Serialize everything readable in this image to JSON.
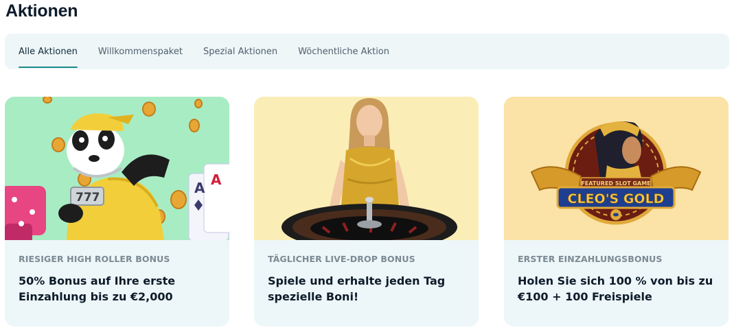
{
  "page": {
    "title": "Aktionen"
  },
  "tabs": [
    {
      "label": "Alle Aktionen",
      "active": true
    },
    {
      "label": "Willkommenspaket",
      "active": false
    },
    {
      "label": "Spezial Aktionen",
      "active": false
    },
    {
      "label": "Wöchentliche Aktion",
      "active": false
    }
  ],
  "cards": [
    {
      "category": "RIESIGER HIGH ROLLER BONUS",
      "text": "50% Bonus auf Ihre erste\nEinzahlung bis zu €2,000",
      "image_bg": "#a8ecc4"
    },
    {
      "category": "TÄGLICHER LIVE-DROP BONUS",
      "text": "Spiele und erhalte jeden Tag\nspezielle Boni!",
      "image_bg": "#fbedb6"
    },
    {
      "category": "ERSTER EINZAHLUNGSBONUS",
      "text": "Holen Sie sich 100 % von bis zu\n€100 + 100 Freispiele",
      "image_bg": "#fbe2a6",
      "logo": {
        "badge": "FEATURED SLOT GAME",
        "title": "CLEO'S GOLD"
      }
    }
  ],
  "colors": {
    "accent": "#1a8a8a",
    "tabbar_bg": "#eef6f8",
    "card_bg": "#edf6f8"
  }
}
